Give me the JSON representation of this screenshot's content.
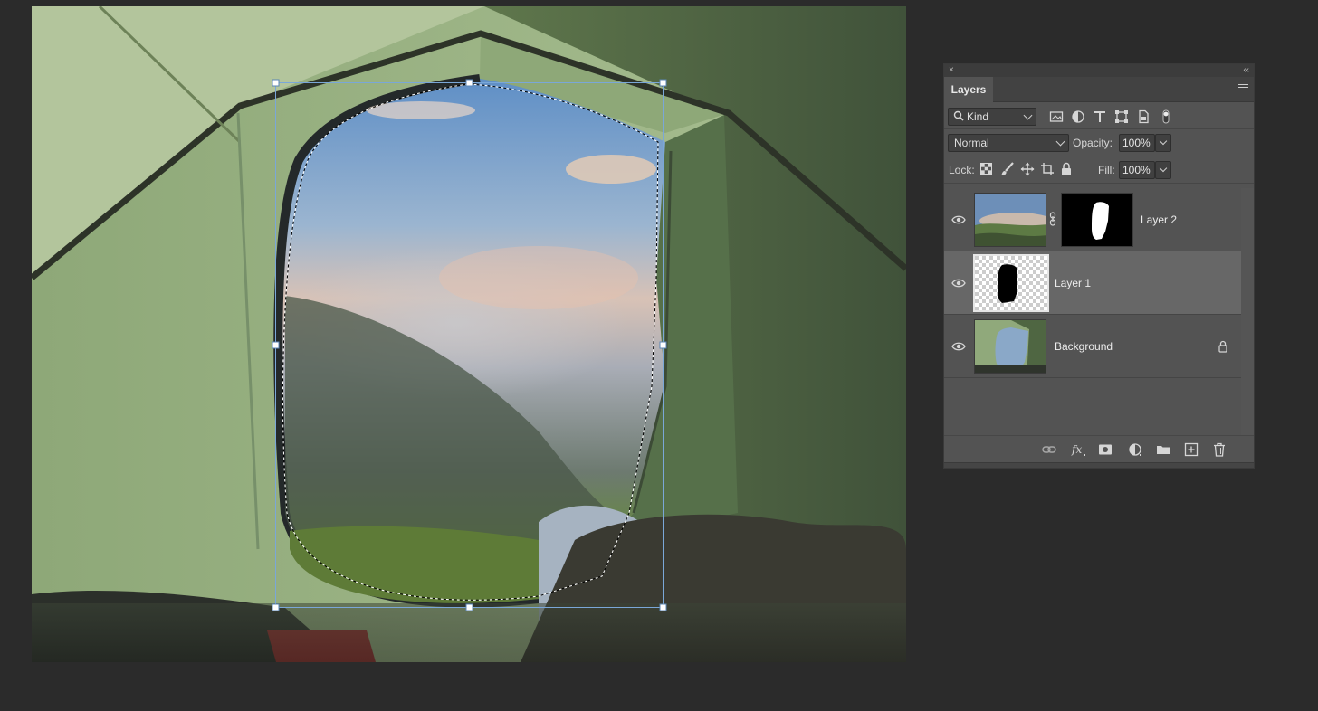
{
  "panel": {
    "close_glyph": "×",
    "collapse_glyph": "‹‹",
    "tab_label": "Layers",
    "filter": {
      "label": "Kind",
      "search_icon": "search-icon"
    },
    "filter_icons": [
      "image-filter-icon",
      "adjustment-filter-icon",
      "type-filter-icon",
      "shape-filter-icon",
      "smart-object-filter-icon",
      "filter-toggle-icon"
    ],
    "blend_mode": "Normal",
    "opacity_label": "Opacity:",
    "opacity_value": "100%",
    "lock_label": "Lock:",
    "lock_icons": [
      "lock-transparent-pixels-icon",
      "lock-image-pixels-icon",
      "lock-position-icon",
      "lock-artboard-icon",
      "lock-all-icon"
    ],
    "fill_label": "Fill:",
    "fill_value": "100%",
    "layers": [
      {
        "name": "Layer 2",
        "visible": true,
        "has_mask": true,
        "selected": false,
        "locked": false
      },
      {
        "name": "Layer 1",
        "visible": true,
        "has_mask": false,
        "selected": true,
        "locked": false
      },
      {
        "name": "Background",
        "visible": true,
        "has_mask": false,
        "selected": false,
        "locked": true
      }
    ],
    "footer_icons": [
      "link-layers-icon",
      "fx-icon",
      "add-mask-icon",
      "adjustment-layer-icon",
      "new-group-icon",
      "new-layer-icon",
      "trash-icon"
    ]
  },
  "colors": {
    "app_background": "#2b2b2b",
    "panel_background": "#535353",
    "selected_layer": "#676767",
    "transform_handle": "#7aa7d8"
  }
}
